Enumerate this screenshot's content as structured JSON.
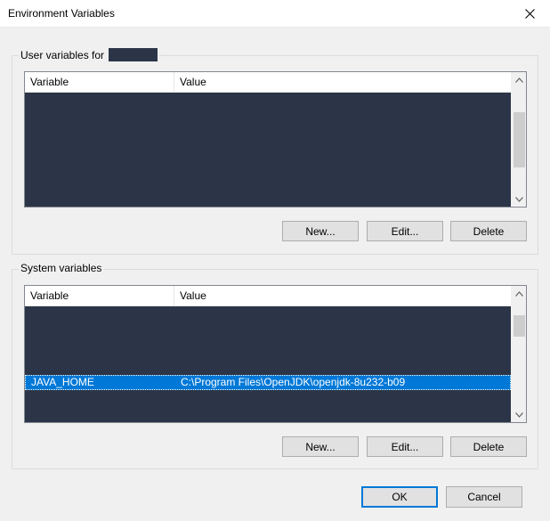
{
  "window": {
    "title": "Environment Variables"
  },
  "user_vars": {
    "group_label": "User variables for",
    "columns": [
      "Variable",
      "Value"
    ],
    "buttons": {
      "new": "New...",
      "edit": "Edit...",
      "delete": "Delete"
    }
  },
  "system_vars": {
    "group_label": "System variables",
    "columns": [
      "Variable",
      "Value"
    ],
    "selected_row": {
      "variable": "JAVA_HOME",
      "value": "C:\\Program Files\\OpenJDK\\openjdk-8u232-b09"
    },
    "buttons": {
      "new": "New...",
      "edit": "Edit...",
      "delete": "Delete"
    }
  },
  "footer": {
    "ok": "OK",
    "cancel": "Cancel"
  },
  "icons": {
    "close": "close-icon",
    "scroll_up": "chevron-up-icon",
    "scroll_down": "chevron-down-icon"
  },
  "colors": {
    "selection": "#0078d7",
    "redacted": "#2b3547"
  }
}
